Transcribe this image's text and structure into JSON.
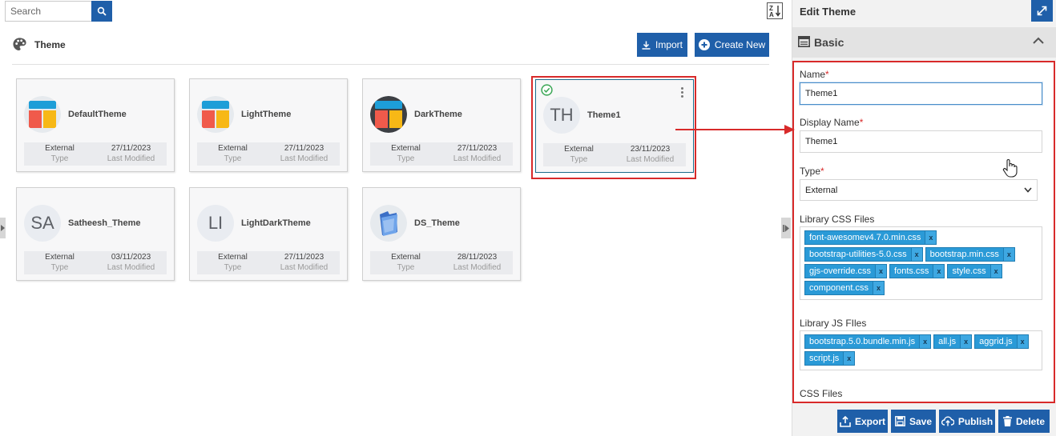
{
  "toolbar": {
    "search_placeholder": "Search",
    "search_icon": "search-icon",
    "sort_icon": "sort-z-a-icon"
  },
  "header": {
    "title": "Theme",
    "icon": "palette-icon",
    "import_label": "Import",
    "create_label": "Create New"
  },
  "cards": [
    {
      "name": "DefaultTheme",
      "avatar": "layout-icon",
      "type": "External",
      "type_label": "Type",
      "modified": "27/11/2023",
      "modified_label": "Last Modified"
    },
    {
      "name": "LightTheme",
      "avatar": "layout-icon",
      "type": "External",
      "type_label": "Type",
      "modified": "27/11/2023",
      "modified_label": "Last Modified"
    },
    {
      "name": "DarkTheme",
      "avatar": "layout-dark-icon",
      "type": "External",
      "type_label": "Type",
      "modified": "27/11/2023",
      "modified_label": "Last Modified"
    },
    {
      "name": "Theme1",
      "avatar_text": "TH",
      "type": "External",
      "type_label": "Type",
      "modified": "23/11/2023",
      "modified_label": "Last Modified",
      "selected": true
    },
    {
      "name": "Satheesh_Theme",
      "avatar_text": "SA",
      "type": "External",
      "type_label": "Type",
      "modified": "03/11/2023",
      "modified_label": "Last Modified"
    },
    {
      "name": "LightDarkTheme",
      "avatar_text": "LI",
      "type": "External",
      "type_label": "Type",
      "modified": "27/11/2023",
      "modified_label": "Last Modified"
    },
    {
      "name": "DS_Theme",
      "avatar": "folder-icon",
      "type": "External",
      "type_label": "Type",
      "modified": "28/11/2023",
      "modified_label": "Last Modified"
    }
  ],
  "panel": {
    "title": "Edit Theme",
    "section": "Basic",
    "name_label": "Name",
    "name_value": "Theme1",
    "display_label": "Display Name",
    "display_value": "Theme1",
    "type_label": "Type",
    "type_value": "External",
    "required_mark": "*",
    "css_label": "Library CSS Files",
    "css_files": [
      "font-awesomev4.7.0.min.css",
      "bootstrap-utilities-5.0.css",
      "bootstrap.min.css",
      "gjs-override.css",
      "fonts.css",
      "style.css",
      "component.css"
    ],
    "js_label": "Library JS FIles",
    "js_files": [
      "bootstrap.5.0.bundle.min.js",
      "all.js",
      "aggrid.js",
      "script.js"
    ],
    "cssfiles_label": "CSS Files",
    "tag_remove": "x",
    "buttons": {
      "export": "Export",
      "save": "Save",
      "publish": "Publish",
      "delete": "Delete"
    }
  },
  "colors": {
    "accent": "#1f5fa9",
    "highlight": "#d82a2a",
    "tag": "#2a9ad7",
    "success": "#3aa655"
  }
}
